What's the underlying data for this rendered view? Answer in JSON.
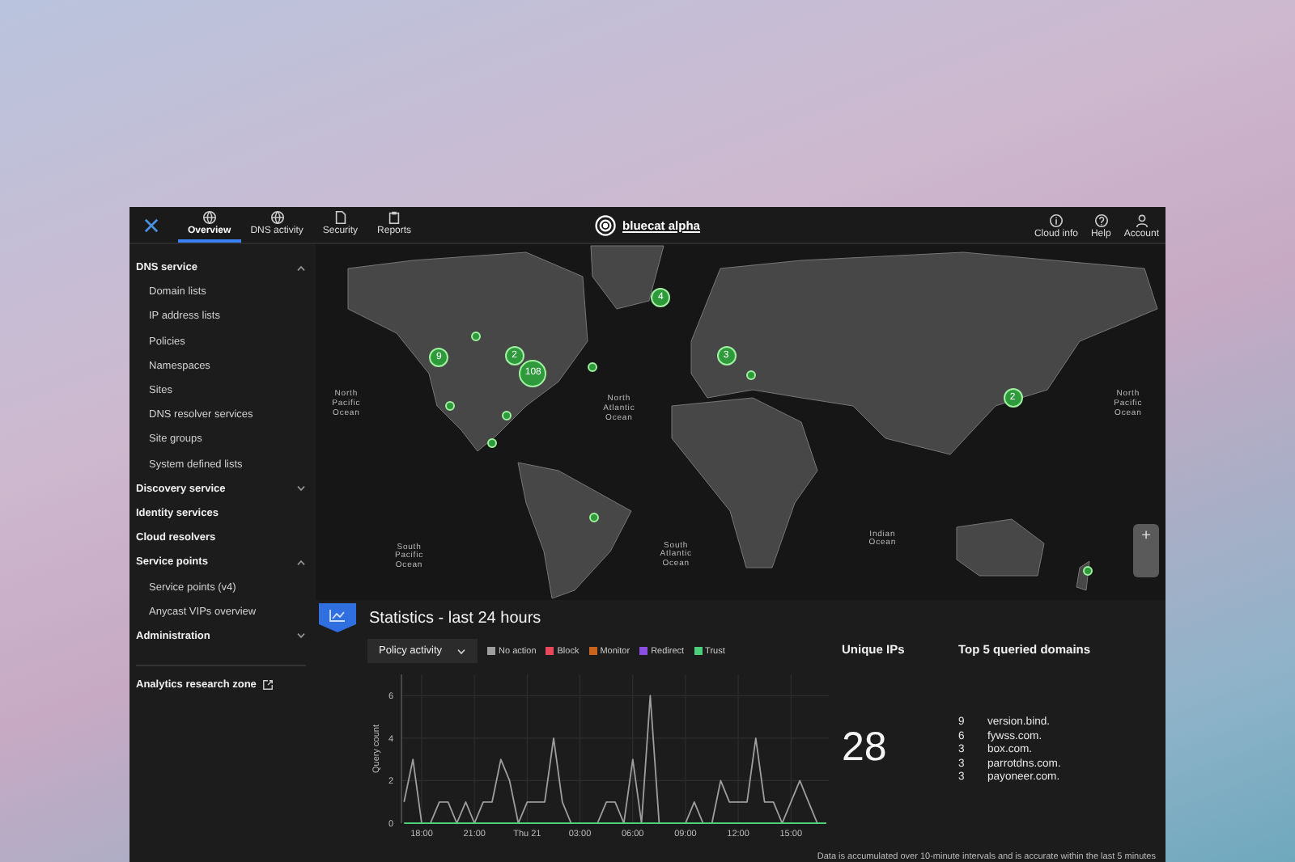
{
  "topbar": {
    "tabs": [
      {
        "label": "Overview",
        "selected": true
      },
      {
        "label": "DNS activity",
        "selected": false
      },
      {
        "label": "Security",
        "selected": false
      },
      {
        "label": "Reports",
        "selected": false
      }
    ],
    "brand": "bluecat alpha",
    "actions": [
      {
        "label": "Cloud info"
      },
      {
        "label": "Help"
      },
      {
        "label": "Account"
      }
    ]
  },
  "sidebar": {
    "sections": [
      {
        "label": "DNS service",
        "kind": "group",
        "expanded": true,
        "items": [
          "Domain lists",
          "IP address lists",
          "Policies",
          "Namespaces",
          "Sites",
          "DNS resolver services",
          "Site groups",
          "System defined lists"
        ]
      },
      {
        "label": "Discovery service",
        "kind": "group",
        "expanded": false
      },
      {
        "label": "Identity services",
        "kind": "link"
      },
      {
        "label": "Cloud resolvers",
        "kind": "link"
      },
      {
        "label": "Service points",
        "kind": "group",
        "expanded": true,
        "items": [
          "Service points (v4)",
          "Anycast VIPs overview"
        ]
      },
      {
        "label": "Administration",
        "kind": "group",
        "expanded": false
      }
    ],
    "footer_link": "Analytics research zone"
  },
  "map": {
    "ocean_labels": [
      "North Pacific Ocean",
      "North Atlantic Ocean",
      "North Pacific Ocean",
      "South Pacific Ocean",
      "South Atlantic Ocean",
      "Indian Ocean"
    ],
    "markers": [
      {
        "kind": "cluster",
        "count": "4"
      },
      {
        "kind": "cluster",
        "count": "9"
      },
      {
        "kind": "cluster",
        "count": "2"
      },
      {
        "kind": "cluster",
        "count": "108"
      },
      {
        "kind": "cluster",
        "count": "3"
      },
      {
        "kind": "cluster",
        "count": "2"
      },
      {
        "kind": "point"
      },
      {
        "kind": "point"
      },
      {
        "kind": "point"
      },
      {
        "kind": "point"
      },
      {
        "kind": "point"
      },
      {
        "kind": "point"
      },
      {
        "kind": "point"
      },
      {
        "kind": "point"
      }
    ],
    "zoom_in": "+"
  },
  "stats": {
    "title": "Statistics - last 24 hours",
    "dropdown": {
      "value": "Policy activity"
    },
    "chart_data": {
      "type": "line",
      "grid": true,
      "ylabel": "Query count",
      "ylim": [
        0,
        7
      ],
      "categories": [
        null,
        null,
        "18:00",
        null,
        null,
        null,
        null,
        null,
        "21:00",
        null,
        null,
        null,
        null,
        null,
        "Thu 21",
        null,
        null,
        null,
        null,
        null,
        "03:00",
        null,
        null,
        null,
        null,
        null,
        "06:00",
        null,
        null,
        null,
        null,
        null,
        "09:00",
        null,
        null,
        null,
        null,
        null,
        "12:00",
        null,
        null,
        null,
        null,
        null,
        "15:00",
        null,
        null,
        null,
        null
      ],
      "yticks": [
        0,
        2,
        4,
        6
      ],
      "series": [
        {
          "name": "No action",
          "color": "#9e9e9e",
          "values": [
            1,
            3,
            0,
            0,
            1,
            1,
            0,
            1,
            0,
            1,
            1,
            3,
            2,
            0,
            1,
            1,
            1,
            4,
            1,
            0,
            0,
            0,
            0,
            1,
            1,
            0,
            3,
            0,
            6,
            0,
            0,
            0,
            0,
            1,
            0,
            0,
            2,
            1,
            1,
            1,
            4,
            1,
            1,
            0,
            1,
            2,
            1,
            0,
            0
          ]
        },
        {
          "name": "Block",
          "color": "#e8485a",
          "values": [
            null,
            null,
            null,
            null,
            null,
            null,
            null,
            null,
            null,
            null,
            null,
            null,
            null,
            null,
            null,
            null,
            null,
            null,
            null,
            null,
            null,
            null,
            null,
            null,
            null,
            null,
            null,
            null,
            null,
            null,
            null,
            null,
            null,
            null,
            null,
            null,
            null,
            null,
            null,
            null,
            null,
            null,
            null,
            null,
            null,
            null,
            null,
            null,
            null
          ]
        },
        {
          "name": "Monitor",
          "color": "#c8641e",
          "values": [
            null,
            null,
            null,
            null,
            null,
            null,
            null,
            null,
            null,
            null,
            null,
            null,
            null,
            null,
            null,
            null,
            null,
            null,
            null,
            null,
            null,
            null,
            null,
            null,
            null,
            null,
            null,
            null,
            null,
            null,
            null,
            null,
            null,
            null,
            null,
            null,
            null,
            null,
            null,
            null,
            null,
            null,
            null,
            null,
            null,
            null,
            null,
            null,
            null
          ]
        },
        {
          "name": "Redirect",
          "color": "#8a4fe0",
          "values": [
            null,
            null,
            null,
            null,
            null,
            null,
            null,
            null,
            null,
            null,
            null,
            null,
            null,
            null,
            null,
            null,
            null,
            null,
            null,
            null,
            null,
            null,
            null,
            null,
            null,
            null,
            null,
            null,
            null,
            null,
            null,
            null,
            null,
            null,
            null,
            null,
            null,
            null,
            null,
            null,
            null,
            null,
            null,
            null,
            null,
            null,
            null,
            null,
            null
          ]
        },
        {
          "name": "Trust",
          "color": "#4ccf7a",
          "values": [
            0,
            0,
            0,
            0,
            0,
            0,
            0,
            0,
            0,
            0,
            0,
            0,
            0,
            0,
            0,
            0,
            0,
            0,
            0,
            0,
            0,
            0,
            0,
            0,
            0,
            0,
            0,
            0,
            0,
            0,
            0,
            0,
            0,
            0,
            0,
            0,
            0,
            0,
            0,
            0,
            0,
            0,
            0,
            0,
            0,
            0,
            0,
            0,
            0
          ]
        }
      ]
    },
    "unique_ips": {
      "heading": "Unique IPs",
      "value": "28"
    },
    "top_domains": {
      "heading": "Top 5 queried domains",
      "rows": [
        {
          "count": "9",
          "domain": "version.bind."
        },
        {
          "count": "6",
          "domain": "fywss.com."
        },
        {
          "count": "3",
          "domain": "box.com."
        },
        {
          "count": "3",
          "domain": "parrotdns.com."
        },
        {
          "count": "3",
          "domain": "payoneer.com."
        }
      ]
    },
    "note": "Data is accumulated over 10-minute intervals and is accurate within the last 5 minutes"
  }
}
